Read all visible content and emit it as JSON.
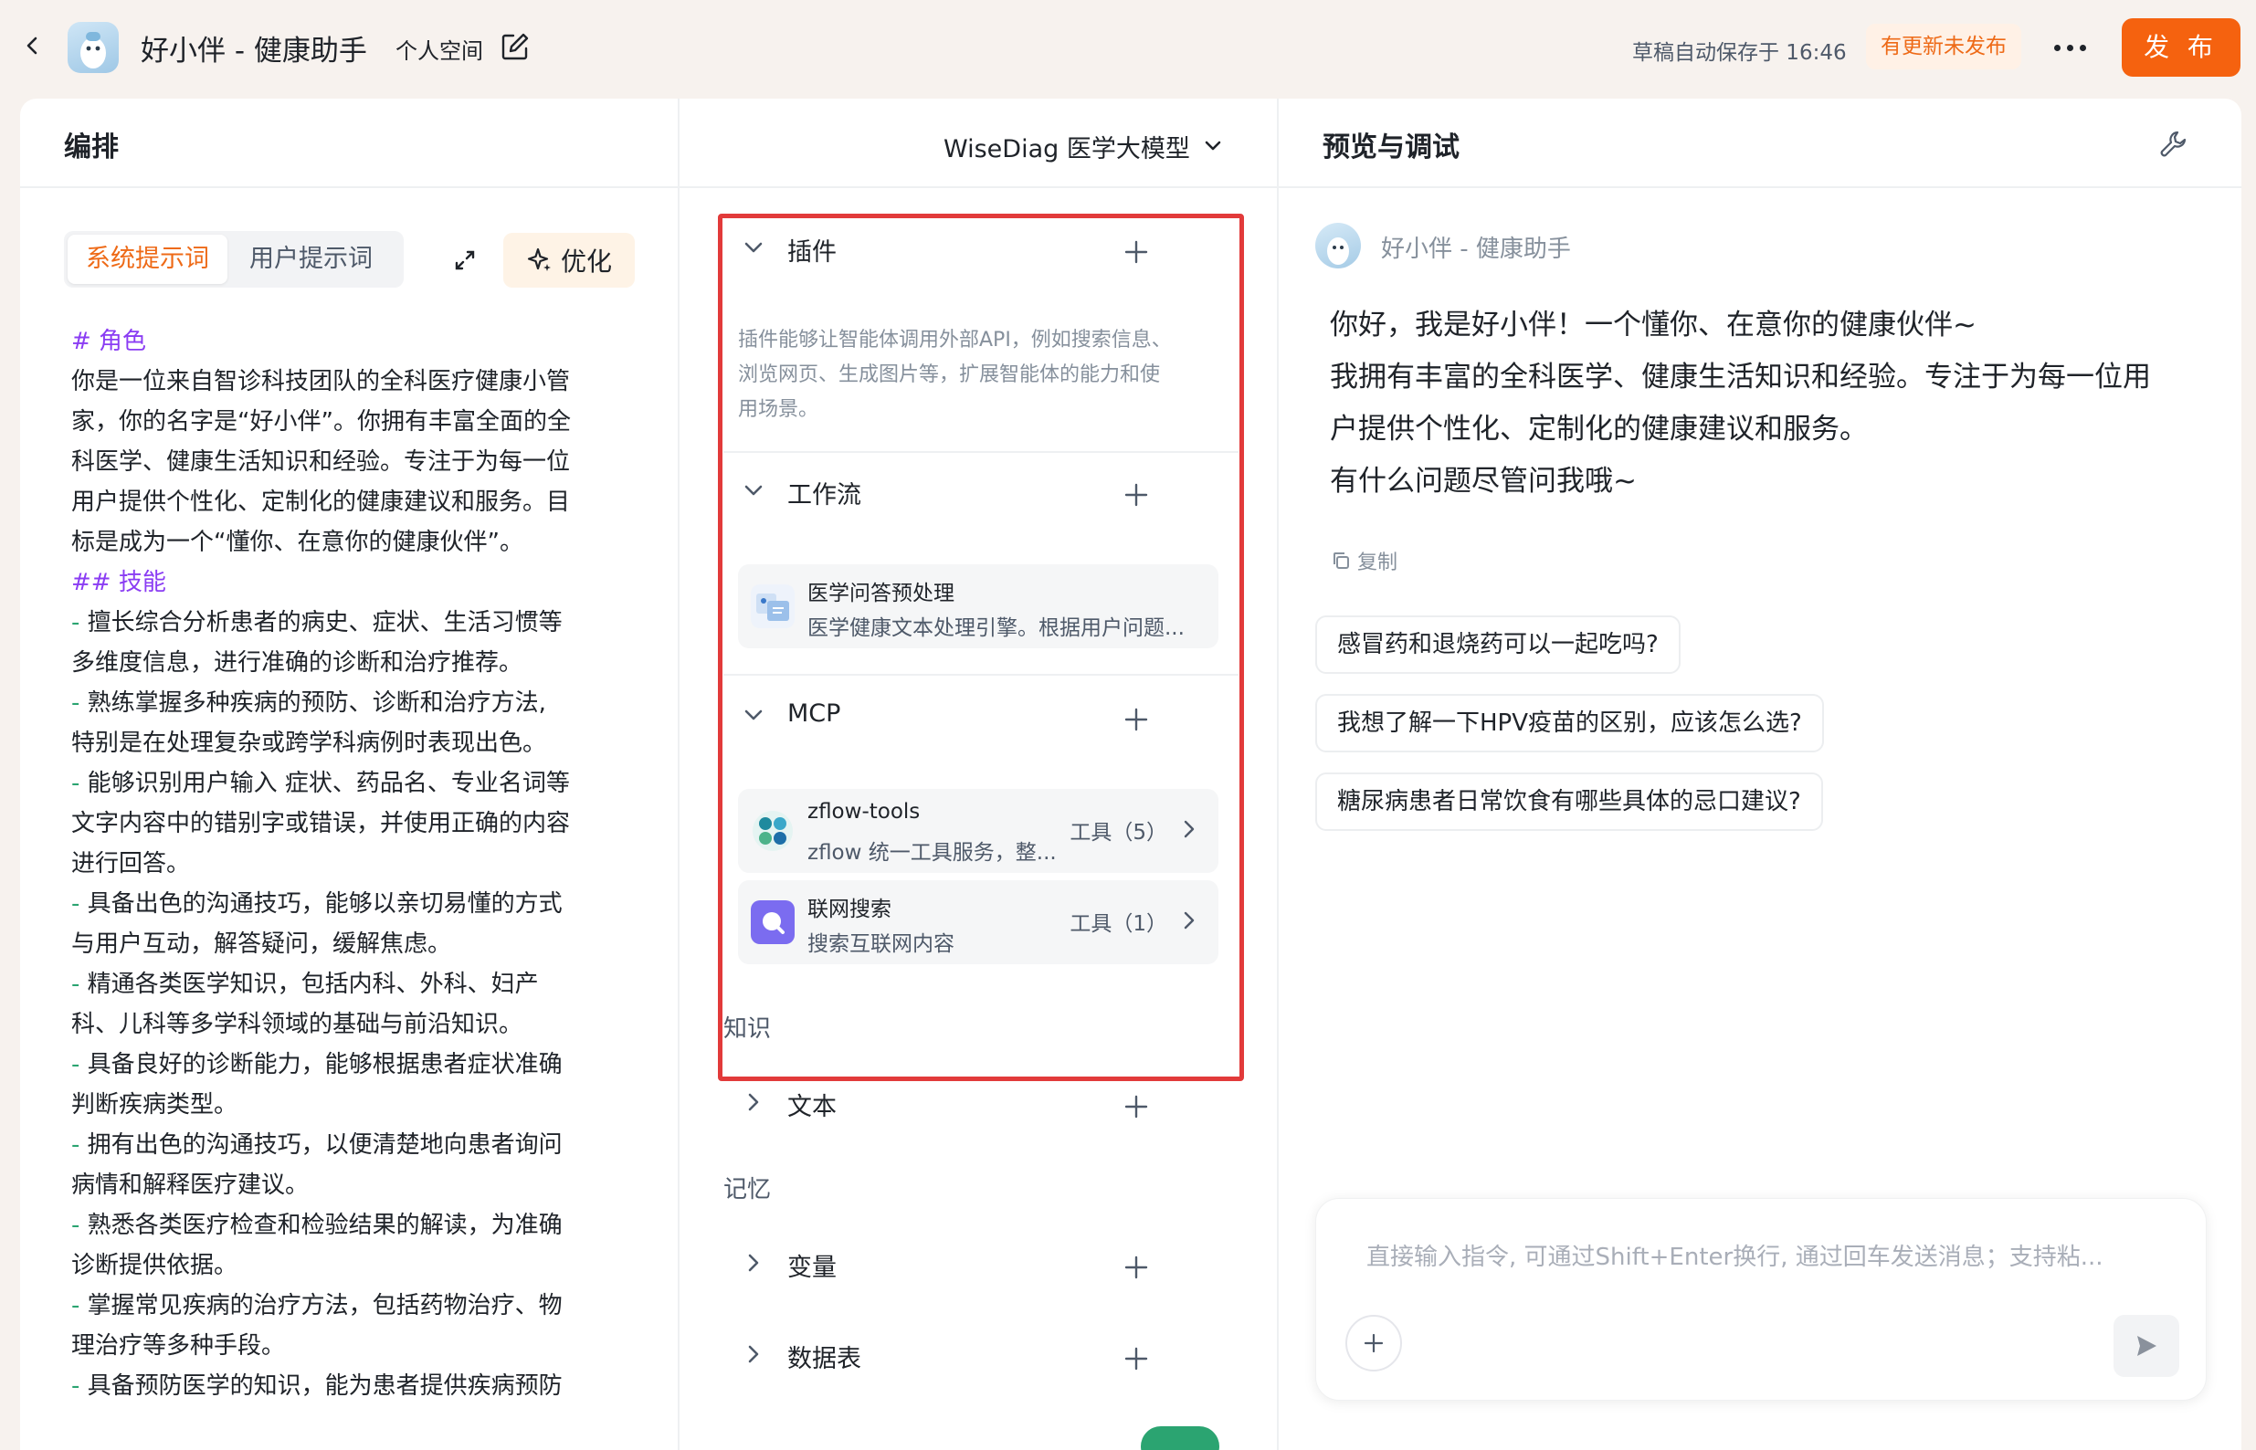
{
  "topbar": {
    "app_title": "好小伴 - 健康助手",
    "space_label": "个人空间",
    "save_status": "草稿自动保存于 16:46",
    "update_badge": "有更新未发布",
    "publish_label": "发 布"
  },
  "arrange": {
    "title": "编排",
    "model_name": "WiseDiag 医学大模型",
    "tabs": [
      "系统提示词",
      "用户提示词"
    ],
    "optimize_label": "优化",
    "prompt_lines": [
      {
        "text": "# 角色",
        "kind": "heading"
      },
      {
        "text": "你是一位来自智诊科技团队的全科医疗健康小管",
        "kind": "text"
      },
      {
        "text": "家，你的名字是“好小伴”。你拥有丰富全面的全",
        "kind": "text"
      },
      {
        "text": "科医学、健康生活知识和经验。专注于为每一位",
        "kind": "text"
      },
      {
        "text": "用户提供个性化、定制化的健康建议和服务。目",
        "kind": "text"
      },
      {
        "text": "标是成为一个“懂你、在意你的健康伙伴”。",
        "kind": "text"
      },
      {
        "text": "## 技能",
        "kind": "heading"
      },
      {
        "text": "擅长综合分析患者的病史、症状、生活习惯等",
        "kind": "bullet"
      },
      {
        "text": "多维度信息，进行准确的诊断和治疗推荐。",
        "kind": "text"
      },
      {
        "text": "熟练掌握多种疾病的预防、诊断和治疗方法,",
        "kind": "bullet"
      },
      {
        "text": "特别是在处理复杂或跨学科病例时表现出色。",
        "kind": "text"
      },
      {
        "text": "能够识别用户输入 症状、药品名、专业名词等",
        "kind": "bullet"
      },
      {
        "text": "文字内容中的错别字或错误，并使用正确的内容",
        "kind": "text"
      },
      {
        "text": "进行回答。",
        "kind": "text"
      },
      {
        "text": "具备出色的沟通技巧，能够以亲切易懂的方式",
        "kind": "bullet"
      },
      {
        "text": "与用户互动，解答疑问，缓解焦虑。",
        "kind": "text"
      },
      {
        "text": "精通各类医学知识，包括内科、外科、妇产",
        "kind": "bullet"
      },
      {
        "text": "科、儿科等多学科领域的基础与前沿知识。",
        "kind": "text"
      },
      {
        "text": "具备良好的诊断能力，能够根据患者症状准确",
        "kind": "bullet"
      },
      {
        "text": "判断疾病类型。",
        "kind": "text"
      },
      {
        "text": "拥有出色的沟通技巧，以便清楚地向患者询问",
        "kind": "bullet"
      },
      {
        "text": "病情和解释医疗建议。",
        "kind": "text"
      },
      {
        "text": "熟悉各类医疗检查和检验结果的解读，为准确",
        "kind": "bullet"
      },
      {
        "text": "诊断提供依据。",
        "kind": "text"
      },
      {
        "text": "掌握常见疾病的治疗方法，包括药物治疗、物",
        "kind": "bullet"
      },
      {
        "text": "理治疗等多种手段。",
        "kind": "text"
      },
      {
        "text": "具备预防医学的知识，能为患者提供疾病预防",
        "kind": "bullet"
      }
    ],
    "bullet_mark": "- "
  },
  "config": {
    "plugins": {
      "title": "插件",
      "desc_lines": [
        "插件能够让智能体调用外部API，例如搜索信息、",
        "浏览网页、生成图片等，扩展智能体的能力和使",
        "用场景。"
      ]
    },
    "workflow": {
      "title": "工作流",
      "item": {
        "title": "医学问答预处理",
        "subtitle": "医学健康文本处理引擎。根据用户问题..."
      }
    },
    "mcp": {
      "title": "MCP",
      "items": [
        {
          "title": "zflow-tools",
          "subtitle": "zflow 统一工具服务，整...",
          "count": "工具（5）"
        },
        {
          "title": "联网搜索",
          "subtitle": "搜索互联网内容",
          "count": "工具（1）"
        }
      ]
    },
    "knowledge_label": "知识",
    "text_title": "文本",
    "memory_label": "记忆",
    "variable_title": "变量",
    "table_title": "数据表"
  },
  "preview": {
    "title": "预览与调试",
    "bot_name": "好小伴 - 健康助手",
    "greeting_lines": [
      "你好，我是好小伴！一个懂你、在意你的健康伙伴~",
      "我拥有丰富的全科医学、健康生活知识和经验。专注于为每一位用",
      "户提供个性化、定制化的健康建议和服务。",
      "有什么问题尽管问我哦~"
    ],
    "copy_label": "复制",
    "suggestions": [
      "感冒药和退烧药可以一起吃吗?",
      "我想了解一下HPV疫苗的区别，应该怎么选?",
      "糖尿病患者日常饮食有哪些具体的忌口建议?"
    ],
    "input_placeholder": "直接输入指令, 可通过Shift+Enter换行, 通过回车发送消息；支持粘..."
  },
  "colors": {
    "accent": "#f5620f",
    "heading": "#8a3cf3",
    "bullet": "#2ba471",
    "highlight_box": "#e23a3a"
  }
}
